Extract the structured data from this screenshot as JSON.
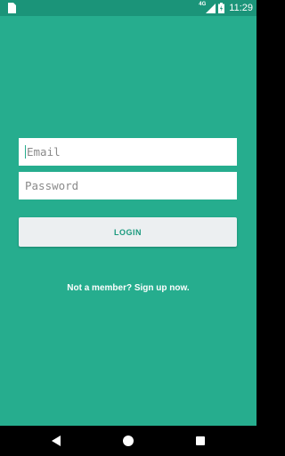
{
  "status_bar": {
    "network": "4G",
    "time": "11:29",
    "icons": [
      "app-notification-icon",
      "signal-icon",
      "battery-icon"
    ]
  },
  "login_form": {
    "email_placeholder": "Email",
    "password_placeholder": "Password",
    "login_label": "LOGIN",
    "signup_text": "Not a member? Sign up now."
  },
  "nav_bar": {
    "icons": [
      "back-icon",
      "home-icon",
      "recents-icon"
    ]
  },
  "colors": {
    "background": "#26ad8e",
    "status_bar": "#1b9479",
    "button_bg": "#eceff1",
    "button_text": "#1a9a7e",
    "field_bg": "#ffffff"
  }
}
